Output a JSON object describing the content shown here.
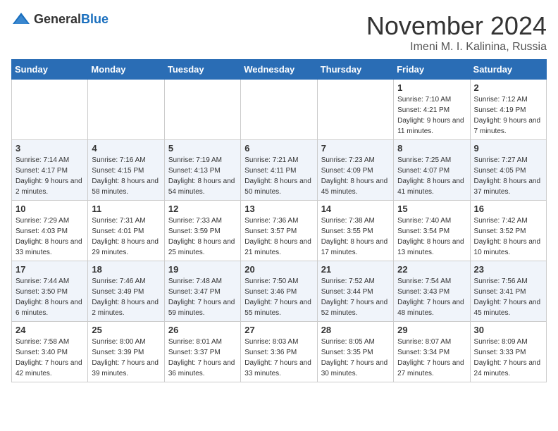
{
  "header": {
    "logo_general": "General",
    "logo_blue": "Blue",
    "title": "November 2024",
    "location": "Imeni M. I. Kalinina, Russia"
  },
  "weekdays": [
    "Sunday",
    "Monday",
    "Tuesday",
    "Wednesday",
    "Thursday",
    "Friday",
    "Saturday"
  ],
  "weeks": [
    [
      {
        "day": "",
        "info": ""
      },
      {
        "day": "",
        "info": ""
      },
      {
        "day": "",
        "info": ""
      },
      {
        "day": "",
        "info": ""
      },
      {
        "day": "",
        "info": ""
      },
      {
        "day": "1",
        "info": "Sunrise: 7:10 AM\nSunset: 4:21 PM\nDaylight: 9 hours and 11 minutes."
      },
      {
        "day": "2",
        "info": "Sunrise: 7:12 AM\nSunset: 4:19 PM\nDaylight: 9 hours and 7 minutes."
      }
    ],
    [
      {
        "day": "3",
        "info": "Sunrise: 7:14 AM\nSunset: 4:17 PM\nDaylight: 9 hours and 2 minutes."
      },
      {
        "day": "4",
        "info": "Sunrise: 7:16 AM\nSunset: 4:15 PM\nDaylight: 8 hours and 58 minutes."
      },
      {
        "day": "5",
        "info": "Sunrise: 7:19 AM\nSunset: 4:13 PM\nDaylight: 8 hours and 54 minutes."
      },
      {
        "day": "6",
        "info": "Sunrise: 7:21 AM\nSunset: 4:11 PM\nDaylight: 8 hours and 50 minutes."
      },
      {
        "day": "7",
        "info": "Sunrise: 7:23 AM\nSunset: 4:09 PM\nDaylight: 8 hours and 45 minutes."
      },
      {
        "day": "8",
        "info": "Sunrise: 7:25 AM\nSunset: 4:07 PM\nDaylight: 8 hours and 41 minutes."
      },
      {
        "day": "9",
        "info": "Sunrise: 7:27 AM\nSunset: 4:05 PM\nDaylight: 8 hours and 37 minutes."
      }
    ],
    [
      {
        "day": "10",
        "info": "Sunrise: 7:29 AM\nSunset: 4:03 PM\nDaylight: 8 hours and 33 minutes."
      },
      {
        "day": "11",
        "info": "Sunrise: 7:31 AM\nSunset: 4:01 PM\nDaylight: 8 hours and 29 minutes."
      },
      {
        "day": "12",
        "info": "Sunrise: 7:33 AM\nSunset: 3:59 PM\nDaylight: 8 hours and 25 minutes."
      },
      {
        "day": "13",
        "info": "Sunrise: 7:36 AM\nSunset: 3:57 PM\nDaylight: 8 hours and 21 minutes."
      },
      {
        "day": "14",
        "info": "Sunrise: 7:38 AM\nSunset: 3:55 PM\nDaylight: 8 hours and 17 minutes."
      },
      {
        "day": "15",
        "info": "Sunrise: 7:40 AM\nSunset: 3:54 PM\nDaylight: 8 hours and 13 minutes."
      },
      {
        "day": "16",
        "info": "Sunrise: 7:42 AM\nSunset: 3:52 PM\nDaylight: 8 hours and 10 minutes."
      }
    ],
    [
      {
        "day": "17",
        "info": "Sunrise: 7:44 AM\nSunset: 3:50 PM\nDaylight: 8 hours and 6 minutes."
      },
      {
        "day": "18",
        "info": "Sunrise: 7:46 AM\nSunset: 3:49 PM\nDaylight: 8 hours and 2 minutes."
      },
      {
        "day": "19",
        "info": "Sunrise: 7:48 AM\nSunset: 3:47 PM\nDaylight: 7 hours and 59 minutes."
      },
      {
        "day": "20",
        "info": "Sunrise: 7:50 AM\nSunset: 3:46 PM\nDaylight: 7 hours and 55 minutes."
      },
      {
        "day": "21",
        "info": "Sunrise: 7:52 AM\nSunset: 3:44 PM\nDaylight: 7 hours and 52 minutes."
      },
      {
        "day": "22",
        "info": "Sunrise: 7:54 AM\nSunset: 3:43 PM\nDaylight: 7 hours and 48 minutes."
      },
      {
        "day": "23",
        "info": "Sunrise: 7:56 AM\nSunset: 3:41 PM\nDaylight: 7 hours and 45 minutes."
      }
    ],
    [
      {
        "day": "24",
        "info": "Sunrise: 7:58 AM\nSunset: 3:40 PM\nDaylight: 7 hours and 42 minutes."
      },
      {
        "day": "25",
        "info": "Sunrise: 8:00 AM\nSunset: 3:39 PM\nDaylight: 7 hours and 39 minutes."
      },
      {
        "day": "26",
        "info": "Sunrise: 8:01 AM\nSunset: 3:37 PM\nDaylight: 7 hours and 36 minutes."
      },
      {
        "day": "27",
        "info": "Sunrise: 8:03 AM\nSunset: 3:36 PM\nDaylight: 7 hours and 33 minutes."
      },
      {
        "day": "28",
        "info": "Sunrise: 8:05 AM\nSunset: 3:35 PM\nDaylight: 7 hours and 30 minutes."
      },
      {
        "day": "29",
        "info": "Sunrise: 8:07 AM\nSunset: 3:34 PM\nDaylight: 7 hours and 27 minutes."
      },
      {
        "day": "30",
        "info": "Sunrise: 8:09 AM\nSunset: 3:33 PM\nDaylight: 7 hours and 24 minutes."
      }
    ]
  ]
}
